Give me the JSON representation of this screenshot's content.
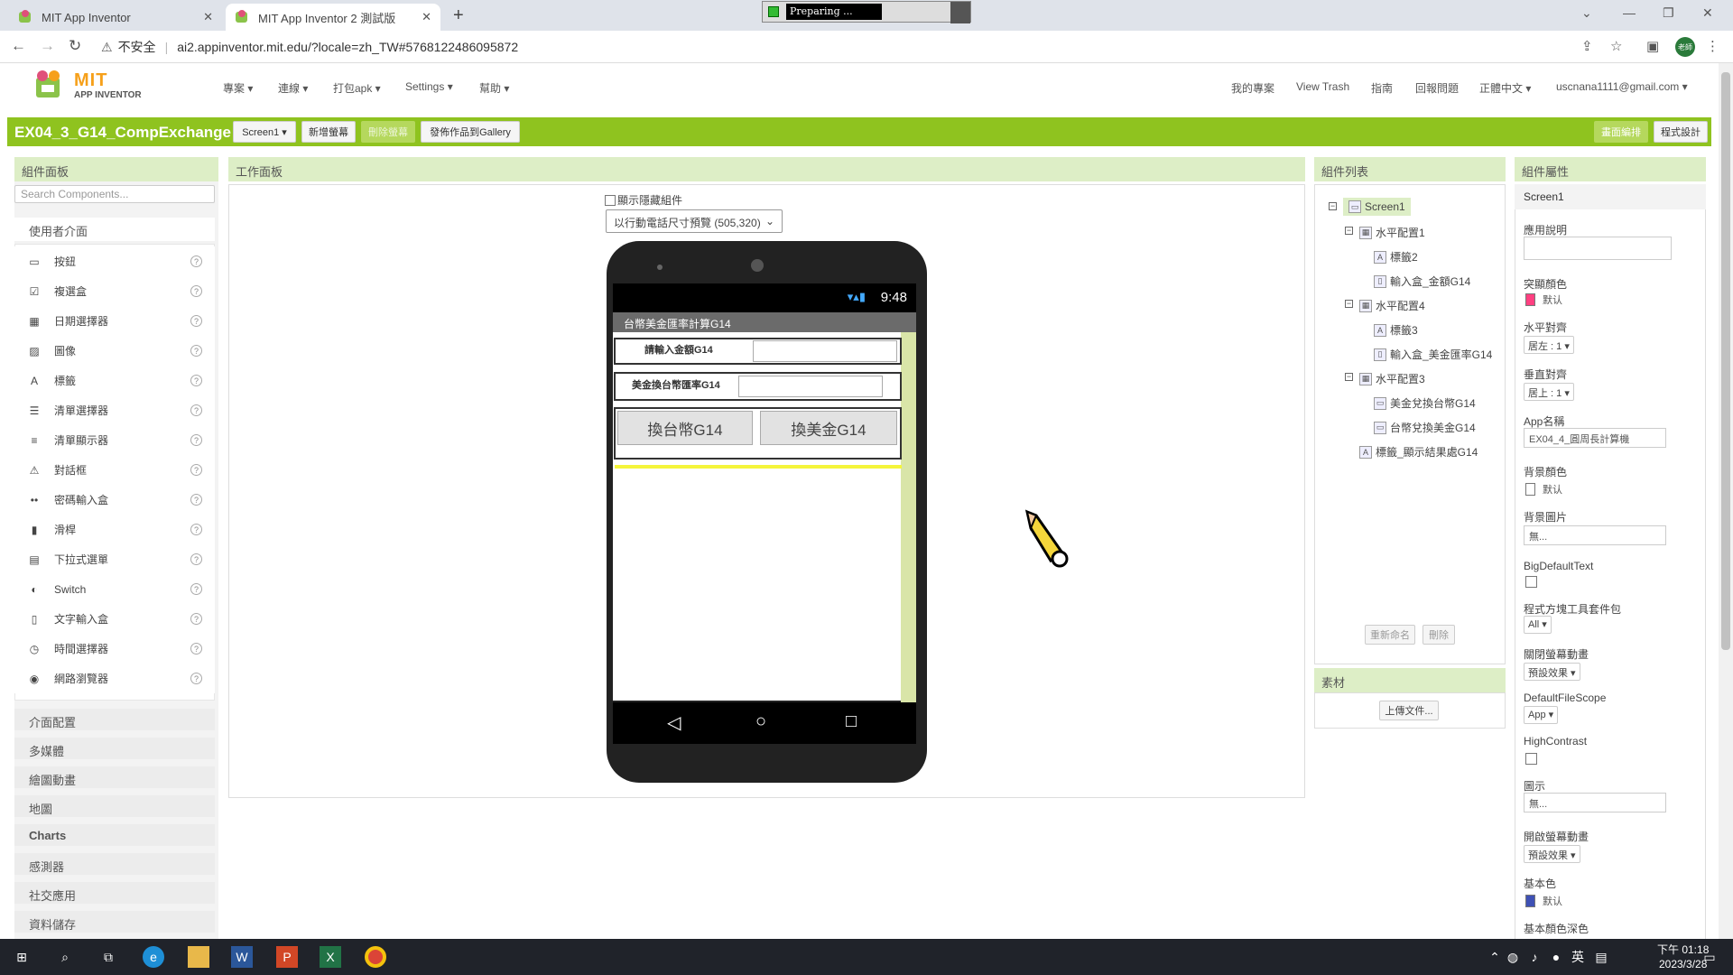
{
  "browser": {
    "tabs": [
      {
        "title": "MIT App Inventor",
        "active": false
      },
      {
        "title": "MIT App Inventor 2 測試版",
        "active": true
      }
    ],
    "preparing": "Preparing ...",
    "insecure": "不安全",
    "url": "ai2.appinventor.mit.edu/?locale=zh_TW#5768122486095872",
    "avatar": "老師"
  },
  "app": {
    "logo_mit": "MIT",
    "logo_ai": "APP INVENTOR",
    "menu": [
      "專案 ▾",
      "連線 ▾",
      "打包apk ▾",
      "Settings ▾",
      "幫助 ▾"
    ],
    "right_menu": [
      "我的專案",
      "View Trash",
      "指南",
      "回報問題",
      "正體中文 ▾",
      "uscnana1111@gmail.com ▾"
    ],
    "project_name": "EX04_3_G14_CompExchange",
    "toolbar": {
      "screen": "Screen1 ▾",
      "add": "新增螢幕",
      "remove": "刪除螢幕",
      "publish": "發佈作品到Gallery",
      "designer": "畫面編排",
      "blocks": "程式設計"
    }
  },
  "palette": {
    "title": "組件面板",
    "search_placeholder": "Search Components...",
    "open_category": "使用者介面",
    "items": [
      {
        "label": "按鈕",
        "icon": "button-icon"
      },
      {
        "label": "複選盒",
        "icon": "checkbox-icon"
      },
      {
        "label": "日期選擇器",
        "icon": "datepicker-icon"
      },
      {
        "label": "圖像",
        "icon": "image-icon"
      },
      {
        "label": "標籤",
        "icon": "label-icon"
      },
      {
        "label": "清單選擇器",
        "icon": "listpicker-icon"
      },
      {
        "label": "清單顯示器",
        "icon": "listview-icon"
      },
      {
        "label": "對話框",
        "icon": "notifier-icon"
      },
      {
        "label": "密碼輸入盒",
        "icon": "password-icon"
      },
      {
        "label": "滑桿",
        "icon": "slider-icon"
      },
      {
        "label": "下拉式選單",
        "icon": "spinner-icon"
      },
      {
        "label": "Switch",
        "icon": "switch-icon"
      },
      {
        "label": "文字輸入盒",
        "icon": "textbox-icon"
      },
      {
        "label": "時間選擇器",
        "icon": "timepicker-icon"
      },
      {
        "label": "網路瀏覽器",
        "icon": "webviewer-icon"
      }
    ],
    "categories": [
      "介面配置",
      "多媒體",
      "繪圖動畫",
      "地圖",
      "Charts",
      "感測器",
      "社交應用",
      "資料儲存"
    ],
    "help": "?"
  },
  "viewer": {
    "title": "工作面板",
    "hidden_checkbox": "顯示隱藏組件",
    "size_select": "以行動電話尺寸預覽 (505,320)",
    "status_time": "9:48",
    "screen_title": "台幣美金匯率計算G14",
    "label1": "請輸入金額G14",
    "label2": "美金換台幣匯率G14",
    "btn1": "換台幣G14",
    "btn2": "換美金G14"
  },
  "tree": {
    "title": "組件列表",
    "nodes": [
      "Screen1",
      "水平配置1",
      "標籤2",
      "輸入盒_金額G14",
      "水平配置4",
      "標籤3",
      "輸入盒_美金匯率G14",
      "水平配置3",
      "美金兌換台幣G14",
      "台幣兌換美金G14",
      "標籤_顯示結果處G14"
    ],
    "rename": "重新命名",
    "delete": "刪除",
    "media_title": "素材",
    "upload": "上傳文件..."
  },
  "props": {
    "title": "組件屬性",
    "component": "Screen1",
    "about": "應用說明",
    "accent": "突顯顏色",
    "accent_val": "默认",
    "halign": "水平對齊",
    "halign_val": "居左 : 1 ▾",
    "valign": "垂直對齊",
    "valign_val": "居上 : 1 ▾",
    "appname": "App名稱",
    "appname_val": "EX04_4_圓周長計算機",
    "bgcolor": "背景顏色",
    "bgcolor_val": "默认",
    "bgimage": "背景圖片",
    "bgimage_val": "無...",
    "bigtext": "BigDefaultText",
    "blocks_toolkit": "程式方塊工具套件包",
    "blocks_toolkit_val": "All ▾",
    "close_anim": "關閉螢幕動畫",
    "close_anim_val": "預設效果 ▾",
    "filescope": "DefaultFileScope",
    "filescope_val": "App ▾",
    "highcontrast": "HighContrast",
    "icon": "圖示",
    "icon_val": "無...",
    "open_anim": "開啟螢幕動畫",
    "open_anim_val": "預設效果 ▾",
    "primary": "基本色",
    "primary_val": "默认",
    "primary_dark": "基本顏色深色",
    "colors": {
      "accent": "#ff4081",
      "bg": "#ffffff",
      "primary": "#3f51b5"
    }
  },
  "taskbar": {
    "time": "下午 01:18",
    "date": "2023/3/28",
    "ime": "英"
  }
}
